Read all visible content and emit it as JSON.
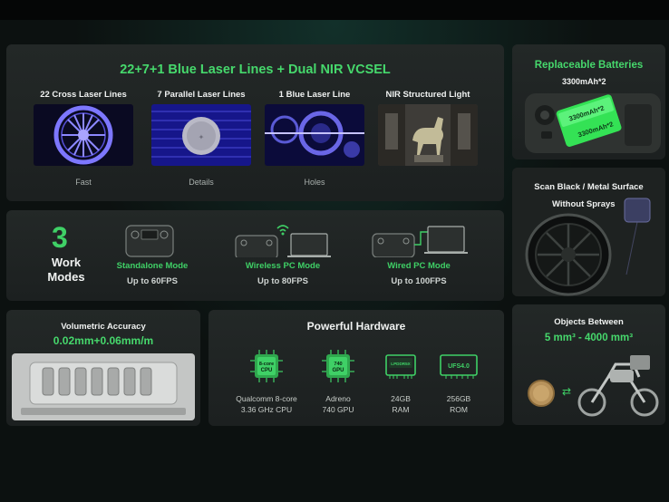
{
  "laser": {
    "title": "22+7+1 Blue Laser Lines + Dual NIR VCSEL",
    "columns": [
      {
        "label": "22 Cross Laser Lines",
        "caption": "Fast"
      },
      {
        "label": "7 Parallel Laser Lines",
        "caption": "Details"
      },
      {
        "label": "1 Blue Laser Line",
        "caption": "Holes"
      },
      {
        "label": "NIR Structured Light",
        "caption": ""
      }
    ]
  },
  "batteries": {
    "title": "Replaceable Batteries",
    "subtitle": "3300mAh*2",
    "cell_label_1": "3300mAh*2",
    "cell_label_2": "3300mAh*2"
  },
  "modes": {
    "count": "3",
    "label": "Work Modes",
    "items": [
      {
        "name": "Standalone Mode",
        "fps": "Up to 60FPS"
      },
      {
        "name": "Wireless PC Mode",
        "fps": "Up to 80FPS"
      },
      {
        "name": "Wired PC Mode",
        "fps": "Up to 100FPS"
      }
    ]
  },
  "scan": {
    "line1": "Scan Black / Metal Surface",
    "line2": "Without Sprays"
  },
  "volumetric": {
    "title": "Volumetric Accuracy",
    "value": "0.02mm+0.06mm/m"
  },
  "hardware": {
    "title": "Powerful Hardware",
    "items": [
      {
        "chip": "8-core CPU",
        "line1": "Qualcomm 8-core",
        "line2": "3.36 GHz CPU"
      },
      {
        "chip": "740 GPU",
        "line1": "Adreno",
        "line2": "740 GPU"
      },
      {
        "chip": "LPDDR5X",
        "line1": "24GB",
        "line2": "RAM"
      },
      {
        "chip": "UFS4.0",
        "line1": "256GB",
        "line2": "ROM"
      }
    ]
  },
  "objects": {
    "title": "Objects Between",
    "range": "5 mm³ - 4000 mm³"
  },
  "colors": {
    "accent": "#3fd066",
    "background": "#0c1110",
    "card": "#212625"
  }
}
